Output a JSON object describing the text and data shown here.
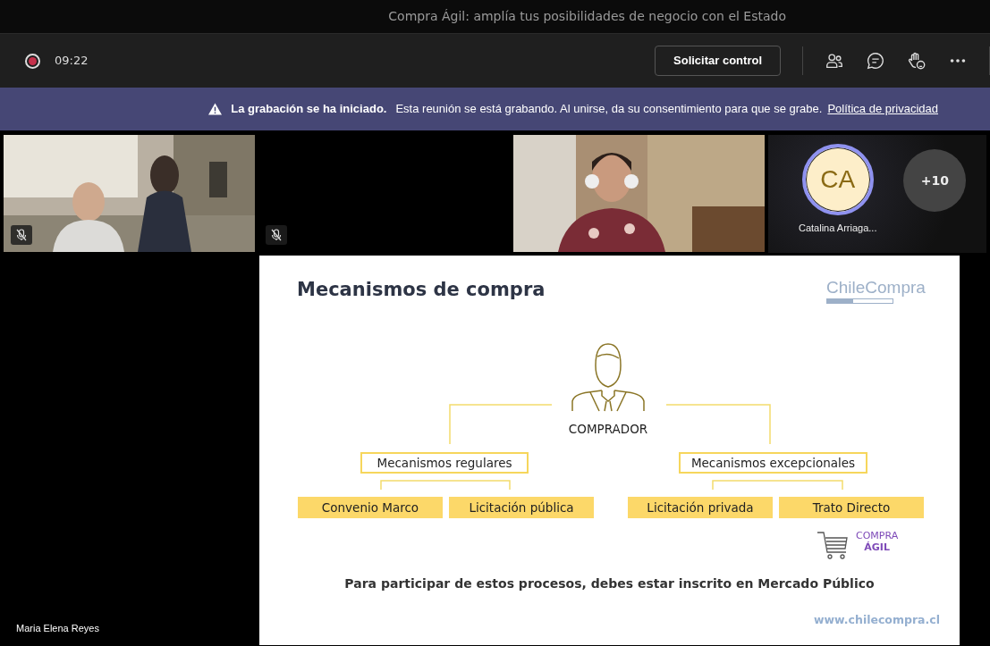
{
  "window": {
    "title": "Compra Ágil: amplía tus posibilidades de negocio con el Estado"
  },
  "toolbar": {
    "elapsed": "09:22",
    "request_control": "Solicitar control"
  },
  "banner": {
    "title": "La grabación se ha iniciado.",
    "message": "Esta reunión se está grabando. Al unirse, da su consentimiento para que se grabe.",
    "link": "Política de privacidad"
  },
  "tiles": [
    {
      "kind": "video",
      "muted": true
    },
    {
      "kind": "empty",
      "muted": true
    },
    {
      "kind": "video",
      "muted": false
    }
  ],
  "avatars": [
    {
      "kind": "person",
      "initials": "CA",
      "name": "Catalina Arriaga..."
    },
    {
      "kind": "overflow",
      "initials": "+10"
    }
  ],
  "presenter": {
    "name": "Maria Elena Reyes"
  },
  "slide": {
    "title": "Mecanismos de compra",
    "logo": "ChileCompra",
    "root": "COMPRADOR",
    "groups": [
      {
        "label": "Mecanismos regulares",
        "items": [
          "Convenio Marco",
          "Licitación pública"
        ]
      },
      {
        "label": "Mecanismos excepcionales",
        "items": [
          "Licitación privada",
          "Trato Directo"
        ]
      }
    ],
    "badge": {
      "line1": "COMPRA",
      "line2": "ÁGIL"
    },
    "note": "Para participar de estos procesos, debes estar inscrito en Mercado Público",
    "url": "www.chilecompra.cl"
  }
}
